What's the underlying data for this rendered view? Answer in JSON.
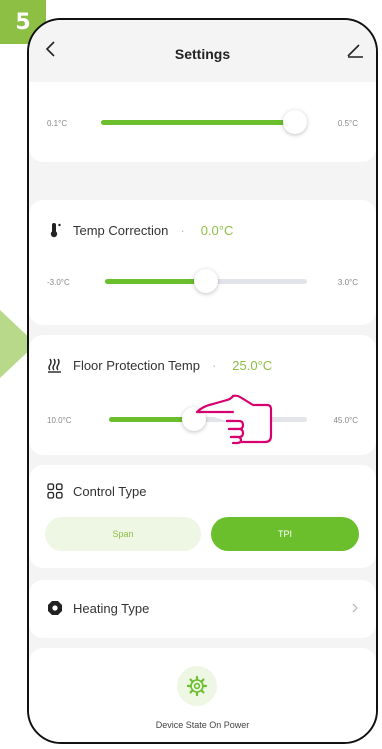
{
  "step_badge": "5",
  "header": {
    "title": "Settings"
  },
  "slider_top": {
    "min_label": "0.1°C",
    "max_label": "0.5°C",
    "level": 0.96
  },
  "temp_correction": {
    "label": "Temp Correction",
    "value": "0.0°C",
    "min_label": "-3.0°C",
    "max_label": "3.0°C",
    "level": 0.5
  },
  "floor_protection": {
    "label": "Floor Protection Temp",
    "value": "25.0°C",
    "min_label": "10.0°C",
    "max_label": "45.0°C",
    "level": 0.43
  },
  "control_type": {
    "label": "Control Type",
    "options": [
      {
        "label": "Span",
        "selected": false
      },
      {
        "label": "TPI",
        "selected": true
      }
    ]
  },
  "heating_type": {
    "label": "Heating Type"
  },
  "device_state": {
    "label": "Device State On Power"
  },
  "icons": {
    "back": "chevron-left-icon",
    "edit": "edit-icon",
    "thermometer": "thermometer-icon",
    "floor_heat": "heat-waves-icon",
    "grid": "grid-icon",
    "heating": "octagon-gear-icon",
    "chevron": "chevron-right-icon",
    "gear": "gear-icon",
    "hand": "pointing-hand-icon"
  },
  "colors": {
    "accent": "#6bbf2c",
    "accent_light": "#eef6e4",
    "badge": "#8dbf45",
    "arrow": "#b8d98a",
    "hand": "#d6006f"
  }
}
